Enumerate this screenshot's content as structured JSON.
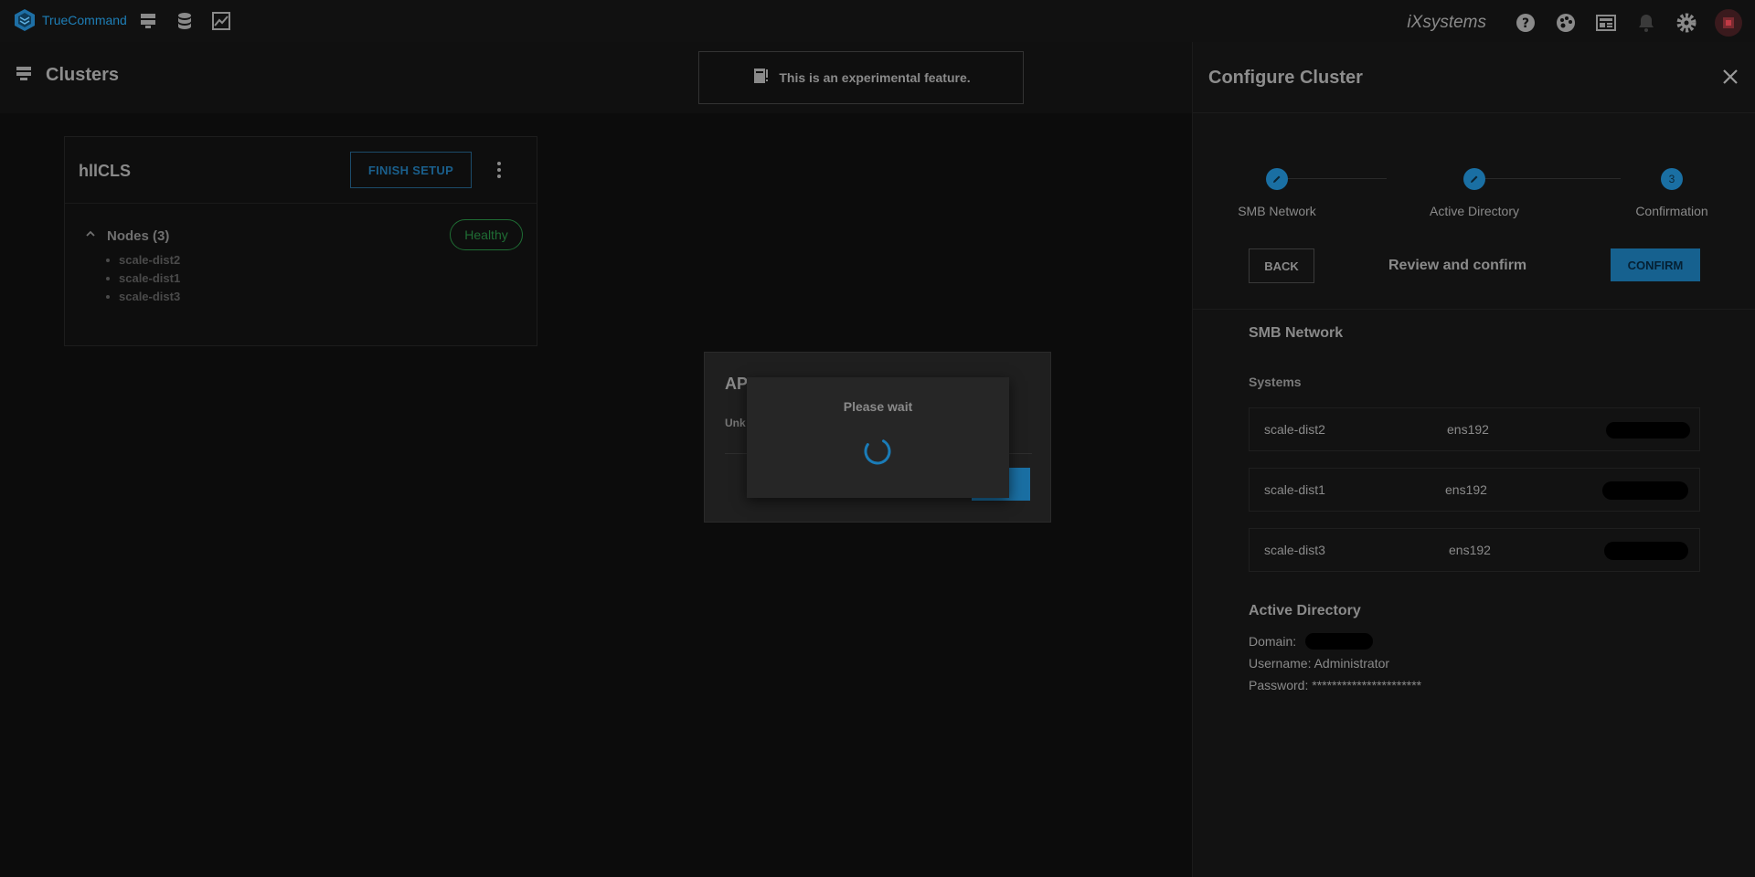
{
  "app": {
    "brand": "TrueCommand",
    "vendor": "iXsystems"
  },
  "page": {
    "title": "Clusters",
    "banner": "This is an experimental feature."
  },
  "cluster_card": {
    "name": "hllCLS",
    "finish_setup_label": "FINISH SETUP",
    "nodes_title": "Nodes (3)",
    "status": "Healthy",
    "nodes": [
      "scale-dist2",
      "scale-dist1",
      "scale-dist3"
    ]
  },
  "api_dialog": {
    "title": "AP",
    "message": "Unk"
  },
  "wait_dialog": {
    "title": "Please wait"
  },
  "configure_panel": {
    "title": "Configure Cluster",
    "steps": [
      {
        "label": "SMB Network",
        "marker": "edit"
      },
      {
        "label": "Active Directory",
        "marker": "edit"
      },
      {
        "label": "Confirmation",
        "marker": "3"
      }
    ],
    "back_label": "BACK",
    "review_label": "Review and confirm",
    "confirm_label": "CONFIRM",
    "smb_section": "SMB Network",
    "systems_label": "Systems",
    "systems": [
      {
        "name": "scale-dist2",
        "interface": "ens192"
      },
      {
        "name": "scale-dist1",
        "interface": "ens192"
      },
      {
        "name": "scale-dist3",
        "interface": "ens192"
      }
    ],
    "ad_section": "Active Directory",
    "domain_label": "Domain:",
    "username_line": "Username: Administrator",
    "password_line": "Password: **********************"
  },
  "colors": {
    "accent": "#1a6fa3",
    "healthy": "#1f6d34",
    "background": "#0c0c0c"
  }
}
